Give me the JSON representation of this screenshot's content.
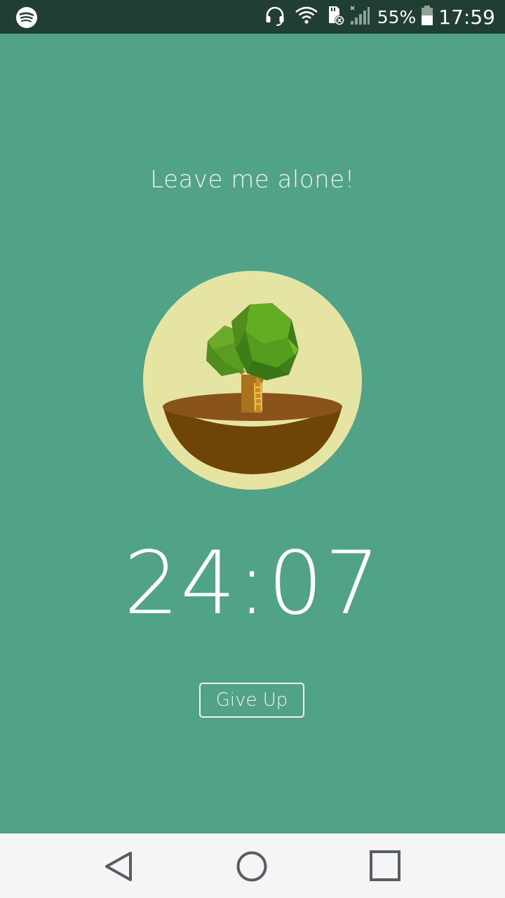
{
  "status_bar": {
    "battery_percent": "55%",
    "time": "17:59",
    "icons": [
      "spotify-icon",
      "headset-icon",
      "wifi-icon",
      "sd-card-error-icon",
      "cell-signal-icon",
      "battery-icon"
    ]
  },
  "main": {
    "motto": "Leave me alone!",
    "timer": "24:07",
    "give_up_label": "Give Up"
  },
  "colors": {
    "background": "#51a387",
    "status_bar": "#213e34",
    "badge": "#e5e4a3",
    "soil": "#8b531c"
  },
  "nav_bar": {
    "icons": [
      "back-icon",
      "home-icon",
      "recents-icon"
    ]
  }
}
